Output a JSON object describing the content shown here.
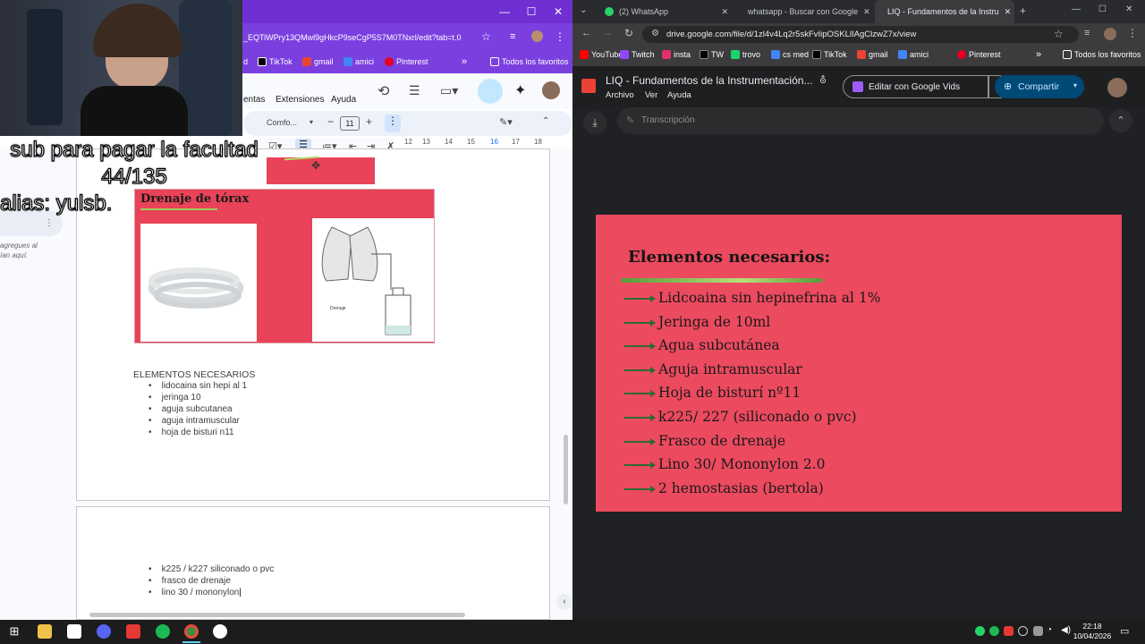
{
  "left": {
    "window_controls": {
      "minimize": "—",
      "maximize": "☐",
      "close": "✕"
    },
    "url": "_EQTiWPry13QMwl9gHkcP9seCgP5S7M0TNxrl/edit?tab=t.0",
    "bookmarks": [
      "d",
      "TikTok",
      "gmail",
      "amici",
      "Pinterest"
    ],
    "all_bookmarks": "Todos los favoritos",
    "menus": [
      "entas",
      "Extensiones",
      "Ayuda"
    ],
    "toolbar": {
      "font": "Comfo...",
      "font_size": "11",
      "minus": "−",
      "plus": "+"
    },
    "ruler_ticks": [
      "12",
      "13",
      "14",
      "15",
      "16",
      "17",
      "18"
    ],
    "side_comment": {
      "line1": "agregues al",
      "line2": "ían aquí."
    },
    "thorax_title": "Drenaje de tórax",
    "thorax_label": "Drenaje",
    "doc_heading": "ELEMENTOS NECESARIOS",
    "doc_items": [
      "lidocaina sin hepi al 1",
      "jeringa 10",
      "aguja subcutanea",
      "aguja intramuscular",
      "hoja de bisturi n11"
    ],
    "doc_items_page2": [
      "k225 / k227 siliconado o pvc",
      "frasco de drenaje",
      "lino 30 / mononylon"
    ]
  },
  "overlay": {
    "line1": "sub para pagar la facultad",
    "line2": "44/135",
    "line3": "alias: yulsb."
  },
  "right": {
    "tabs": [
      "(2) WhatsApp",
      "whatsapp - Buscar con Google",
      "LIQ - Fundamentos de la Instru"
    ],
    "url": "drive.google.com/file/d/1zl4v4Lq2r5skFvIipOSKLlIAgClzwZ7x/view",
    "bookmarks": [
      "YouTube",
      "Twitch",
      "insta",
      "TW",
      "trovo",
      "cs med",
      "TikTok",
      "gmail",
      "amici",
      "Pinterest"
    ],
    "all_bookmarks": "Todos los favoritos",
    "file_title": "LIQ - Fundamentos de la Instrumentación...",
    "menus": [
      "Archivo",
      "Ver",
      "Ayuda"
    ],
    "edit_vids": "Editar con Google Vids",
    "share": "Compartir",
    "transcript": "Transcripción"
  },
  "slide": {
    "title": "Elementos necesarios:",
    "items": [
      "Lidcoaina sin hepinefrina al 1%",
      "Jeringa de 10ml",
      "Agua subcutánea",
      "Aguja intramuscular",
      "Hoja de bisturí nº11",
      "k225/ 227 (siliconado o pvc)",
      "Frasco de drenaje",
      "Lino 30/ Mononylon 2.0",
      "2 hemostasias (bertola)"
    ]
  },
  "taskbar": {
    "time": "22:18",
    "date": "10/04/2026"
  }
}
